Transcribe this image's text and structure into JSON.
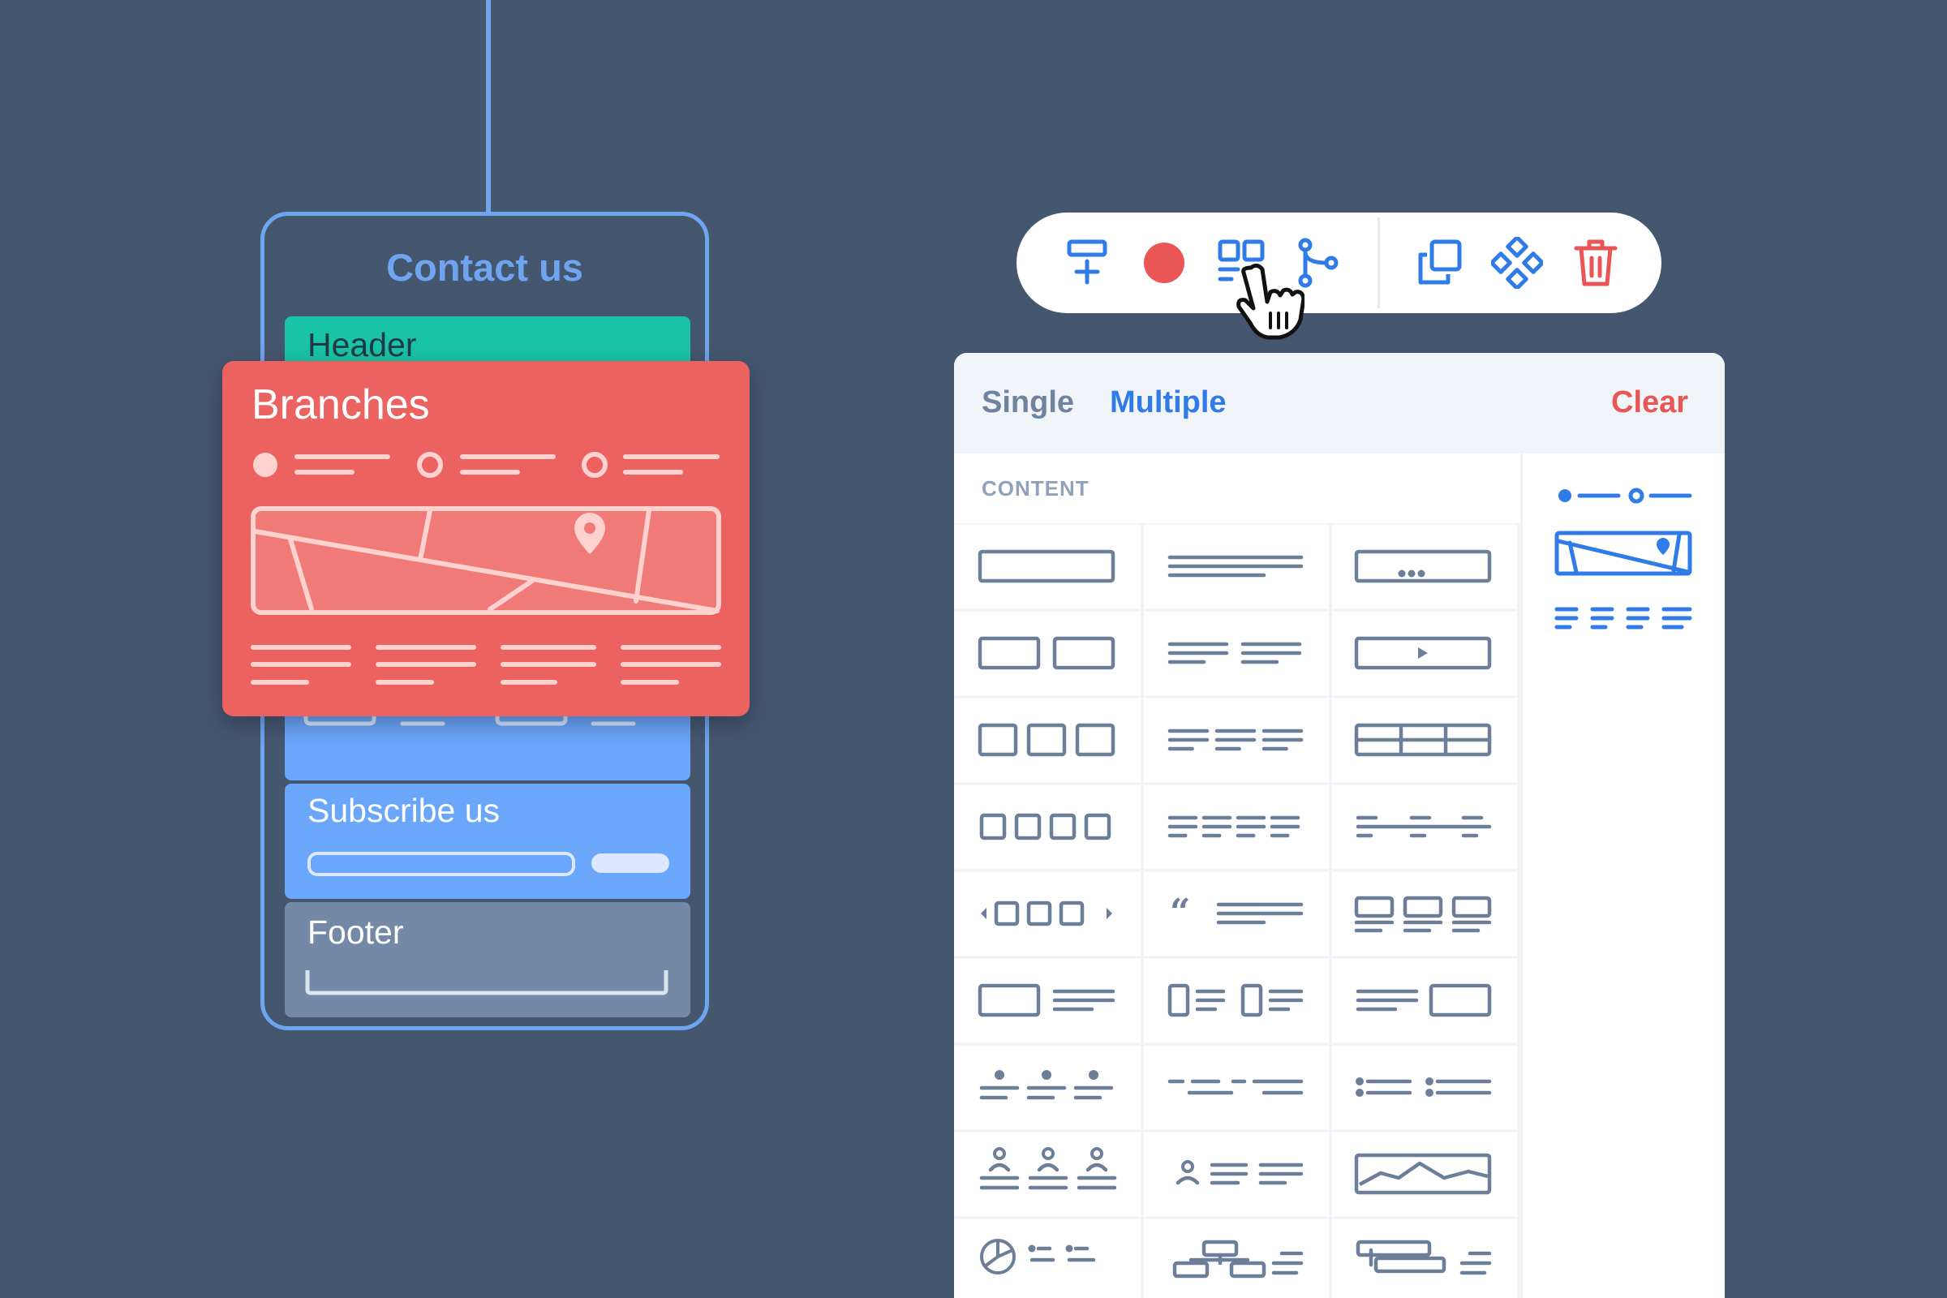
{
  "phone": {
    "title": "Contact us",
    "header_label": "Header",
    "subscribe_label": "Subscribe us",
    "footer_label": "Footer"
  },
  "branches_card": {
    "title": "Branches",
    "icons": [
      "map-pin-icon"
    ]
  },
  "toolbar": {
    "buttons": [
      "add-row-icon",
      "record-icon",
      "blocks-layout-icon",
      "branch-icon",
      "duplicate-icon",
      "component-icon",
      "trash-icon"
    ]
  },
  "cursor": {
    "icon": "hand-pointer-icon"
  },
  "panel": {
    "tab_single": "Single",
    "tab_multiple": "Multiple",
    "clear_label": "Clear",
    "section_label": "CONTENT"
  },
  "colors": {
    "background": "#45566f",
    "accent_blue": "#2f7be8",
    "phone_blue": "#6fa4f0",
    "teal": "#19c3a6",
    "coral": "#ec6260",
    "footer_gray": "#7389a6",
    "icon_gray": "#6d7f98",
    "danger": "#ea5656"
  },
  "layout_grid": {
    "rows": [
      [
        "wide-box",
        "text-lines",
        "box-with-dots"
      ],
      [
        "two-boxes",
        "two-text-columns",
        "video-player"
      ],
      [
        "three-boxes",
        "three-text-columns",
        "table"
      ],
      [
        "four-boxes",
        "four-text-columns",
        "timeline"
      ],
      [
        "carousel",
        "quote",
        "three-cards"
      ],
      [
        "box-and-text",
        "two-box-text-pairs",
        "text-and-box"
      ],
      [
        "three-bullets-vertical",
        "dashed-lines",
        "bullet-list"
      ],
      [
        "three-people",
        "person-with-text",
        "chart"
      ],
      [
        "pie-with-list",
        "org-chart",
        "gantt"
      ]
    ]
  }
}
